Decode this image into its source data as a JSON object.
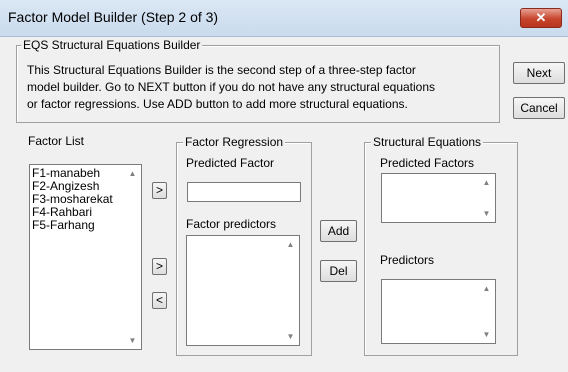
{
  "window": {
    "title": "Factor Model Builder (Step 2 of 3)",
    "close_glyph": "✕"
  },
  "builder": {
    "group_title": "EQS Structural Equations Builder",
    "description": [
      "This Structural Equations Builder is the second step of a three-step factor",
      "model builder.  Go to NEXT button if you do not have any structural equations",
      "or factor regressions.  Use ADD button to add more structural equations."
    ]
  },
  "buttons": {
    "next": "Next",
    "cancel": "Cancel",
    "add": "Add",
    "del": "Del",
    "move_right": ">",
    "move_right_2": ">",
    "move_left": "<"
  },
  "factor_list": {
    "label": "Factor List",
    "items": [
      "F1-manabeh",
      "F2-Angizesh",
      "F3-mosharekat",
      "F4-Rahbari",
      "F5-Farhang"
    ]
  },
  "factor_regression": {
    "group_title": "Factor Regression",
    "predicted_label": "Predicted Factor",
    "predicted_value": "",
    "predictors_label": "Factor predictors"
  },
  "structural_equations": {
    "group_title": "Structural Equations",
    "predicted_label": "Predicted Factors",
    "predictors_label": "Predictors"
  },
  "glyphs": {
    "scroll_up": "▲",
    "scroll_down": "▼"
  }
}
